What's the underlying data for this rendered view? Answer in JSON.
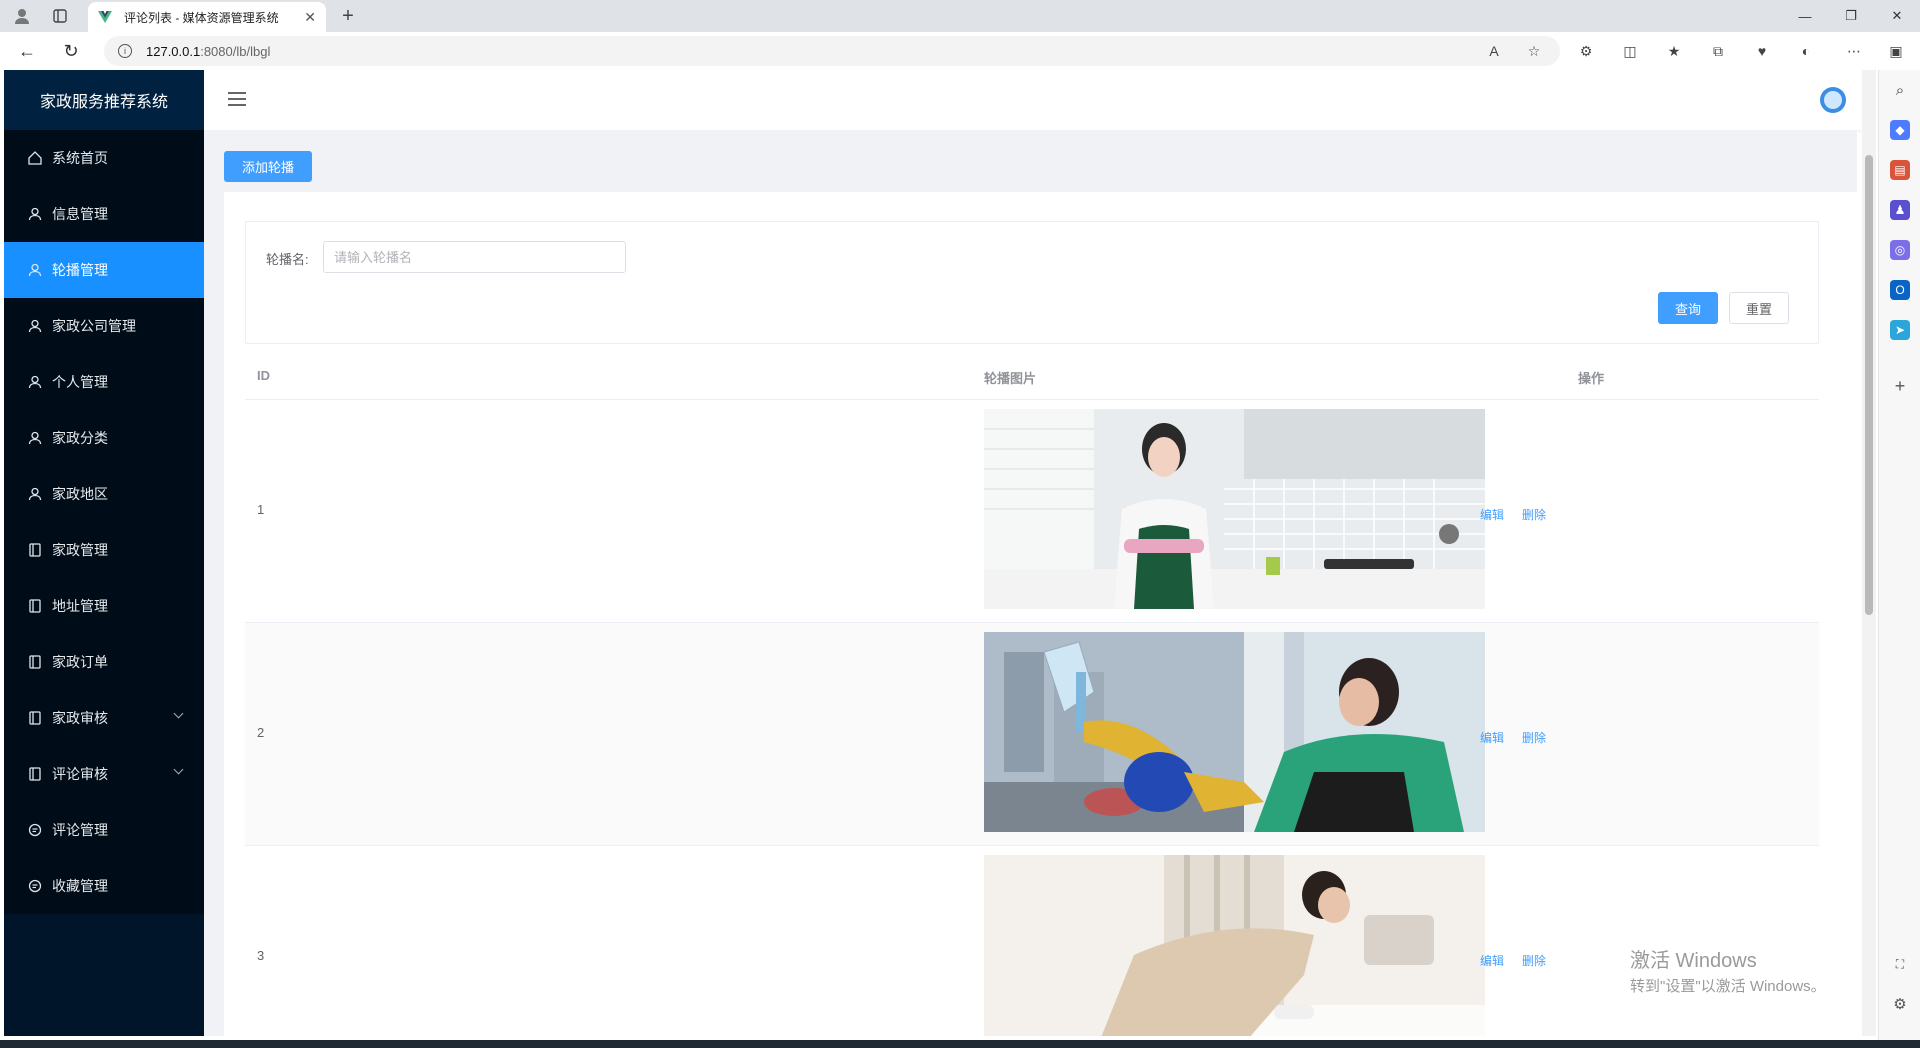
{
  "browser": {
    "tab_title": "评论列表 - 媒体资源管理系统",
    "url_host": "127.0.0.1",
    "url_rest": ":8080/lb/lbgl"
  },
  "app": {
    "brand": "家政服务推荐系统",
    "menu": [
      {
        "label": "系统首页",
        "icon": "home-icon"
      },
      {
        "label": "信息管理",
        "icon": "user-icon"
      },
      {
        "label": "轮播管理",
        "icon": "user-icon",
        "active": true
      },
      {
        "label": "家政公司管理",
        "icon": "user-icon"
      },
      {
        "label": "个人管理",
        "icon": "user-icon"
      },
      {
        "label": "家政分类",
        "icon": "user-icon"
      },
      {
        "label": "家政地区",
        "icon": "user-icon"
      },
      {
        "label": "家政管理",
        "icon": "document-icon"
      },
      {
        "label": "地址管理",
        "icon": "document-icon"
      },
      {
        "label": "家政订单",
        "icon": "document-icon"
      },
      {
        "label": "家政审核",
        "icon": "document-icon",
        "expandable": true
      },
      {
        "label": "评论审核",
        "icon": "document-icon",
        "expandable": true
      },
      {
        "label": "评论管理",
        "icon": "chat-icon"
      },
      {
        "label": "收藏管理",
        "icon": "chat-icon"
      }
    ]
  },
  "toolbar": {
    "add_label": "添加轮播"
  },
  "search": {
    "label": "轮播名:",
    "placeholder": "请输入轮播名",
    "query_label": "查询",
    "reset_label": "重置"
  },
  "table": {
    "headers": {
      "id": "ID",
      "image": "轮播图片",
      "ops": "操作"
    },
    "rows": [
      {
        "id": "1",
        "edit": "编辑",
        "delete": "删除"
      },
      {
        "id": "2",
        "edit": "编辑",
        "delete": "删除"
      },
      {
        "id": "3",
        "edit": "编辑",
        "delete": "删除"
      }
    ]
  },
  "watermark": {
    "line1": "激活 Windows",
    "line2": "转到\"设置\"以激活 Windows。"
  },
  "colors": {
    "sidebar_bg": "#001529",
    "active_menu": "#1890ff",
    "primary": "#409eff"
  }
}
